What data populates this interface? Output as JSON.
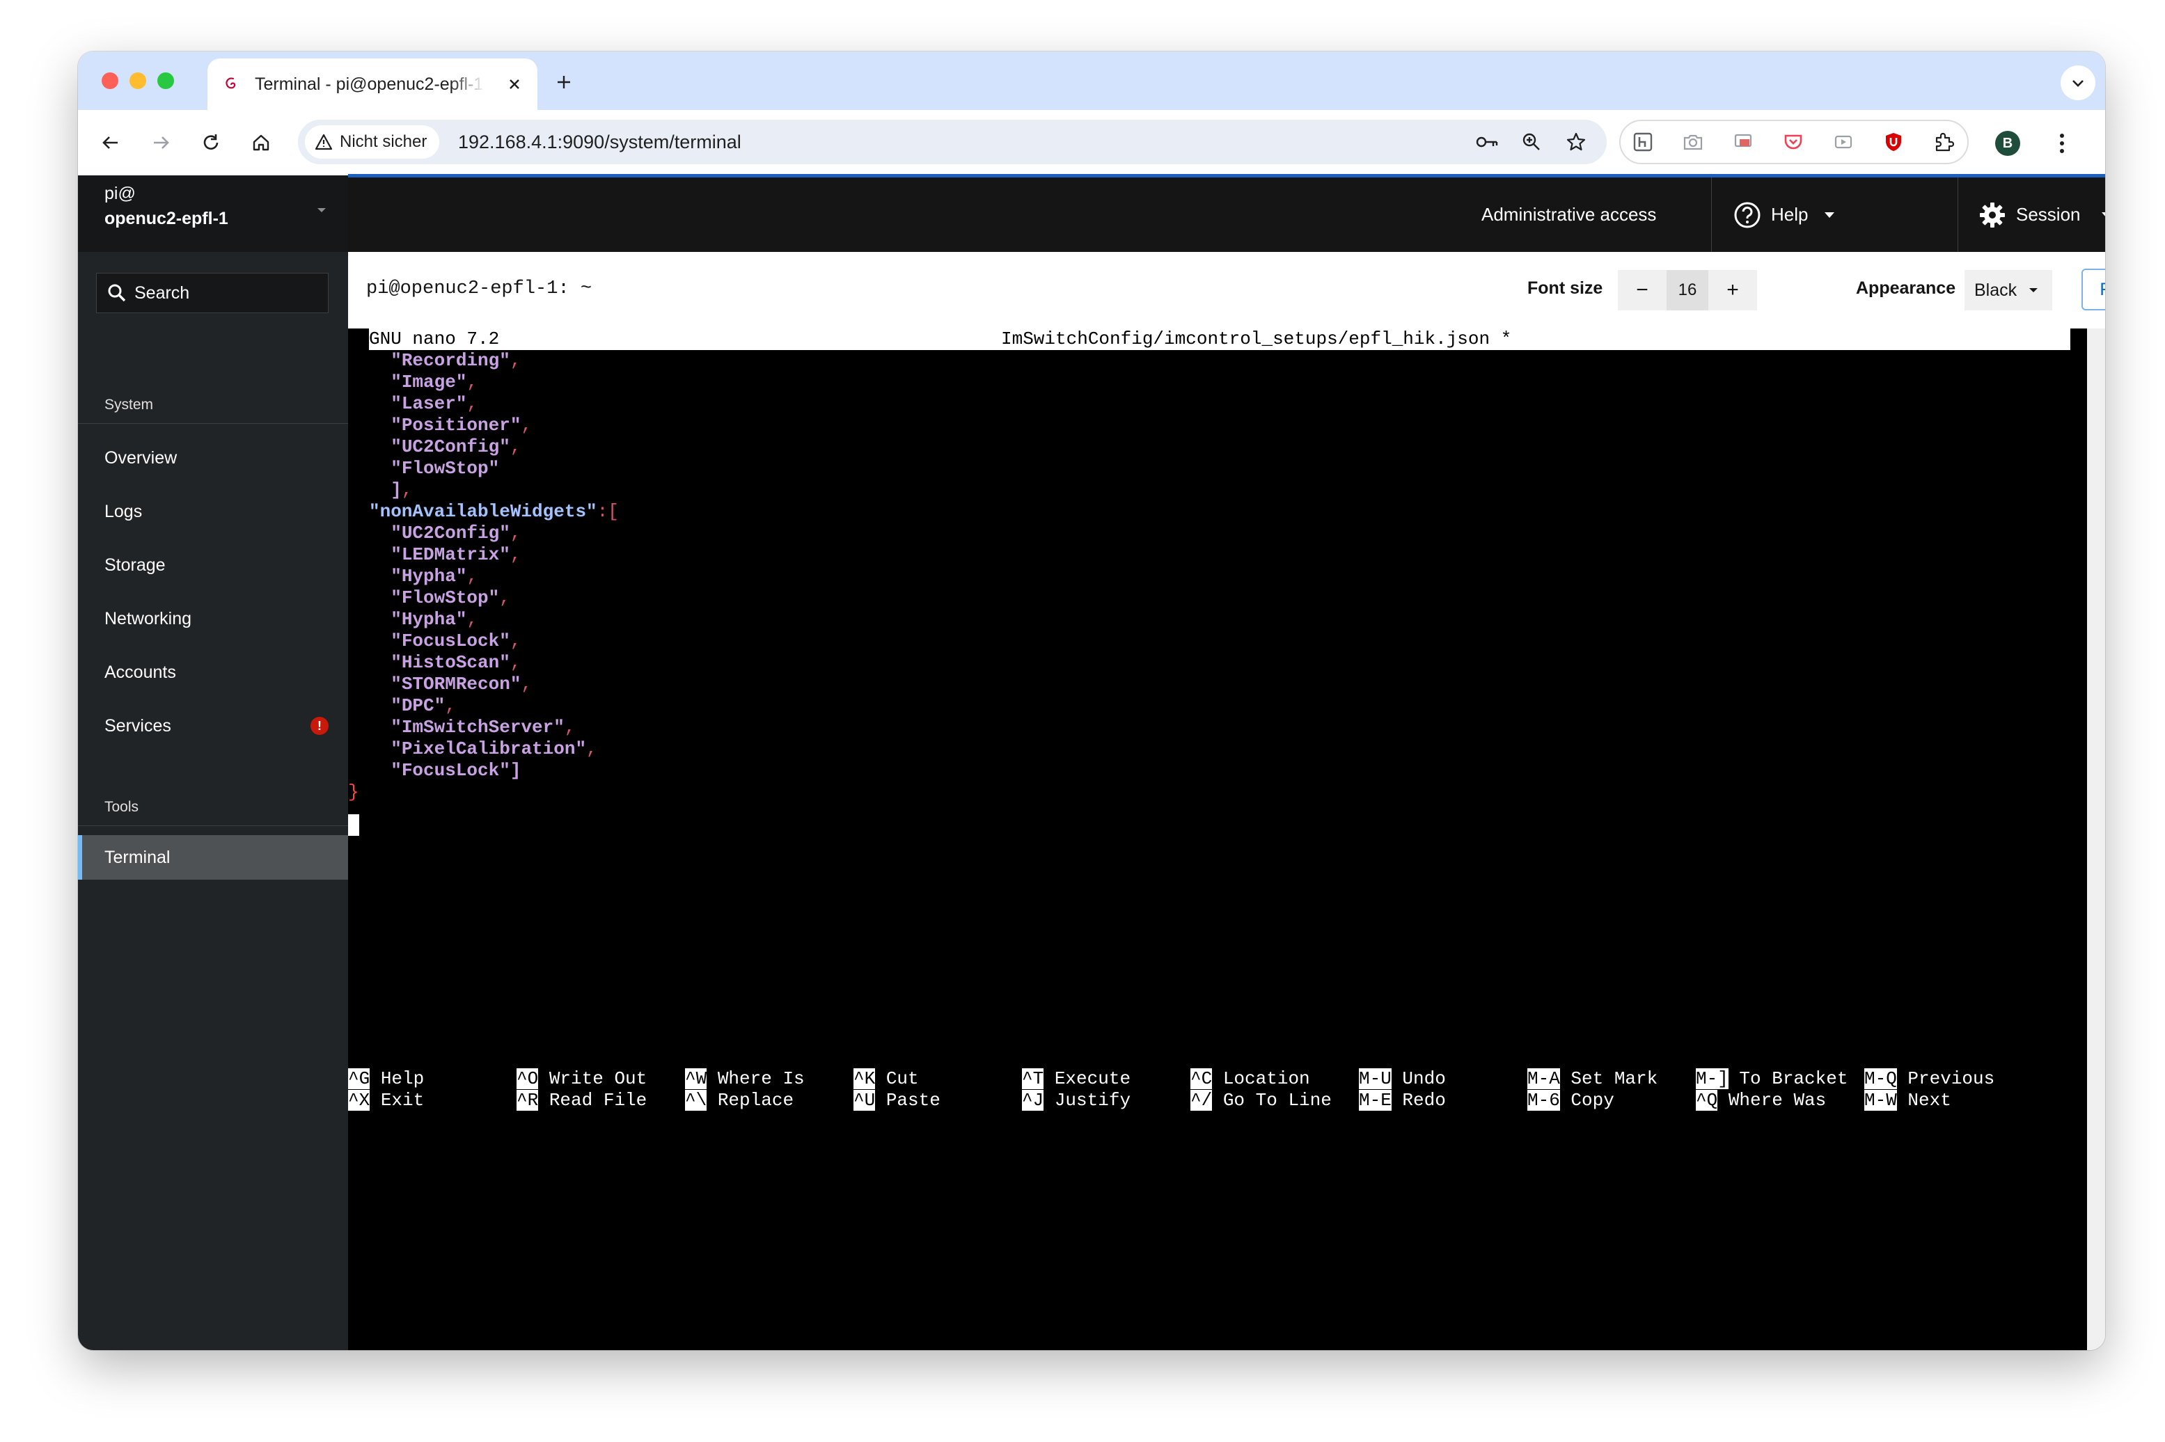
{
  "browser": {
    "tab_title": "Terminal - pi@openuc2-epfl-1",
    "security_label": "Nicht sicher",
    "url": "192.168.4.1:9090/system/terminal",
    "profile_initial": "B"
  },
  "sidebar": {
    "host_user": "pi@",
    "host_name": "openuc2-epfl-1",
    "search_label": "Search",
    "section_system": "System",
    "items": [
      {
        "label": "Overview"
      },
      {
        "label": "Logs"
      },
      {
        "label": "Storage"
      },
      {
        "label": "Networking"
      },
      {
        "label": "Accounts"
      },
      {
        "label": "Services",
        "alert": "!"
      }
    ],
    "section_tools": "Tools",
    "tools_items": [
      {
        "label": "Terminal",
        "active": true
      }
    ]
  },
  "masthead": {
    "admin_access": "Administrative access",
    "help": "Help",
    "session": "Session"
  },
  "terminal_toolbar": {
    "title": "pi@openuc2-epfl-1: ~",
    "font_size_label": "Font size",
    "font_size_value": "16",
    "minus": "−",
    "plus": "+",
    "appearance_label": "Appearance",
    "appearance_value": "Black",
    "reset": "Reset"
  },
  "nano": {
    "version": "GNU nano 7.2",
    "filename": "ImSwitchConfig/imcontrol_setups/epfl_hik.json *",
    "lines": [
      {
        "indent": "  ",
        "text": "\"Recording\"",
        "punct": ",",
        "kind": "str"
      },
      {
        "indent": "  ",
        "text": "\"Image\"",
        "punct": ",",
        "kind": "str"
      },
      {
        "indent": "  ",
        "text": "\"Laser\"",
        "punct": ",",
        "kind": "str"
      },
      {
        "indent": "  ",
        "text": "\"Positioner\"",
        "punct": ",",
        "kind": "str"
      },
      {
        "indent": "  ",
        "text": "\"UC2Config\"",
        "punct": ",",
        "kind": "str"
      },
      {
        "indent": "  ",
        "text": "\"FlowStop\"",
        "punct": "",
        "kind": "str"
      },
      {
        "indent": "  ",
        "text": "]",
        "punct": ",",
        "kind": "str"
      },
      {
        "indent": "",
        "text": "\"nonAvailableWidgets\"",
        "punct": ":[",
        "kind": "key"
      },
      {
        "indent": "  ",
        "text": "\"UC2Config\"",
        "punct": ",",
        "kind": "str"
      },
      {
        "indent": "  ",
        "text": "\"LEDMatrix\"",
        "punct": ",",
        "kind": "str"
      },
      {
        "indent": "  ",
        "text": "\"Hypha\"",
        "punct": ",",
        "kind": "str"
      },
      {
        "indent": "  ",
        "text": "\"FlowStop\"",
        "punct": ",",
        "kind": "str"
      },
      {
        "indent": "  ",
        "text": "\"Hypha\"",
        "punct": ",",
        "kind": "str"
      },
      {
        "indent": "  ",
        "text": "\"FocusLock\"",
        "punct": ",",
        "kind": "str"
      },
      {
        "indent": "  ",
        "text": "\"HistoScan\"",
        "punct": ",",
        "kind": "str"
      },
      {
        "indent": "  ",
        "text": "\"STORMRecon\"",
        "punct": ",",
        "kind": "str"
      },
      {
        "indent": "  ",
        "text": "\"DPC\"",
        "punct": ",",
        "kind": "str"
      },
      {
        "indent": "  ",
        "text": "\"ImSwitchServer\"",
        "punct": ",",
        "kind": "str"
      },
      {
        "indent": "  ",
        "text": "\"PixelCalibration\"",
        "punct": ",",
        "kind": "str"
      },
      {
        "indent": "  ",
        "text": "\"FocusLock\"]",
        "punct": "",
        "kind": "str"
      }
    ],
    "closing_brace": "}",
    "shortcuts_row1": [
      {
        "key": "^G",
        "label": "Help"
      },
      {
        "key": "^O",
        "label": "Write Out"
      },
      {
        "key": "^W",
        "label": "Where Is"
      },
      {
        "key": "^K",
        "label": "Cut"
      },
      {
        "key": "^T",
        "label": "Execute"
      },
      {
        "key": "^C",
        "label": "Location"
      },
      {
        "key": "M-U",
        "label": "Undo"
      },
      {
        "key": "M-A",
        "label": "Set Mark"
      },
      {
        "key": "M-]",
        "label": "To Bracket"
      },
      {
        "key": "M-Q",
        "label": "Previous"
      }
    ],
    "shortcuts_row2": [
      {
        "key": "^X",
        "label": "Exit"
      },
      {
        "key": "^R",
        "label": "Read File"
      },
      {
        "key": "^\\",
        "label": "Replace"
      },
      {
        "key": "^U",
        "label": "Paste"
      },
      {
        "key": "^J",
        "label": "Justify"
      },
      {
        "key": "^/",
        "label": "Go To Line"
      },
      {
        "key": "M-E",
        "label": "Redo"
      },
      {
        "key": "M-6",
        "label": "Copy"
      },
      {
        "key": "^Q",
        "label": "Where Was"
      },
      {
        "key": "M-W",
        "label": "Next"
      }
    ]
  },
  "colors": {
    "tabstrip": "#d3e3fd",
    "sidebar": "#212427",
    "masthead": "#151515",
    "accent": "#0066cc",
    "terminal_bg": "#000000",
    "json_string": "#c9a2e4",
    "json_key": "#a3c3ff",
    "alert": "#c9190b"
  }
}
